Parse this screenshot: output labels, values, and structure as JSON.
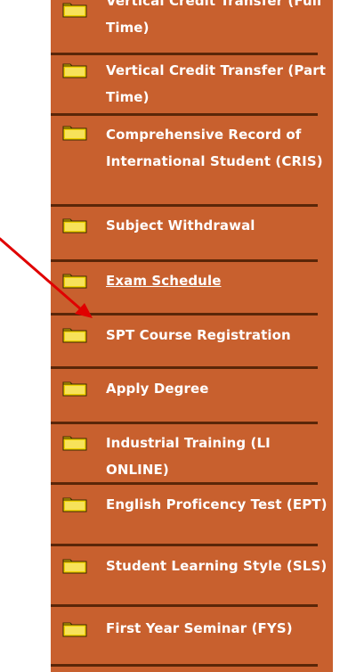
{
  "menu": {
    "items": [
      {
        "label": "Vertical Credit Transfer (Full Time)",
        "icon": "folder-icon"
      },
      {
        "label": "Vertical Credit Transfer (Part Time)",
        "icon": "folder-icon"
      },
      {
        "label": "Comprehensive Record of International Student (CRIS)",
        "icon": "folder-icon"
      },
      {
        "label": "Subject Withdrawal",
        "icon": "folder-icon"
      },
      {
        "label": "Exam Schedule",
        "icon": "folder-icon"
      },
      {
        "label": "SPT Course Registration",
        "icon": "folder-icon"
      },
      {
        "label": "Apply Degree",
        "icon": "folder-icon"
      },
      {
        "label": "Industrial Training (LI ONLINE)",
        "icon": "folder-icon"
      },
      {
        "label": "English Proficency Test (EPT)",
        "icon": "folder-icon"
      },
      {
        "label": "Student Learning Style (SLS)",
        "icon": "folder-icon"
      },
      {
        "label": "First Year Seminar (FYS)",
        "icon": "folder-icon"
      }
    ]
  },
  "colors": {
    "panel": "#c8602e",
    "separator": "#5a2608",
    "text": "#ffffff",
    "folder": "#f0d000",
    "arrow": "#e00000"
  }
}
